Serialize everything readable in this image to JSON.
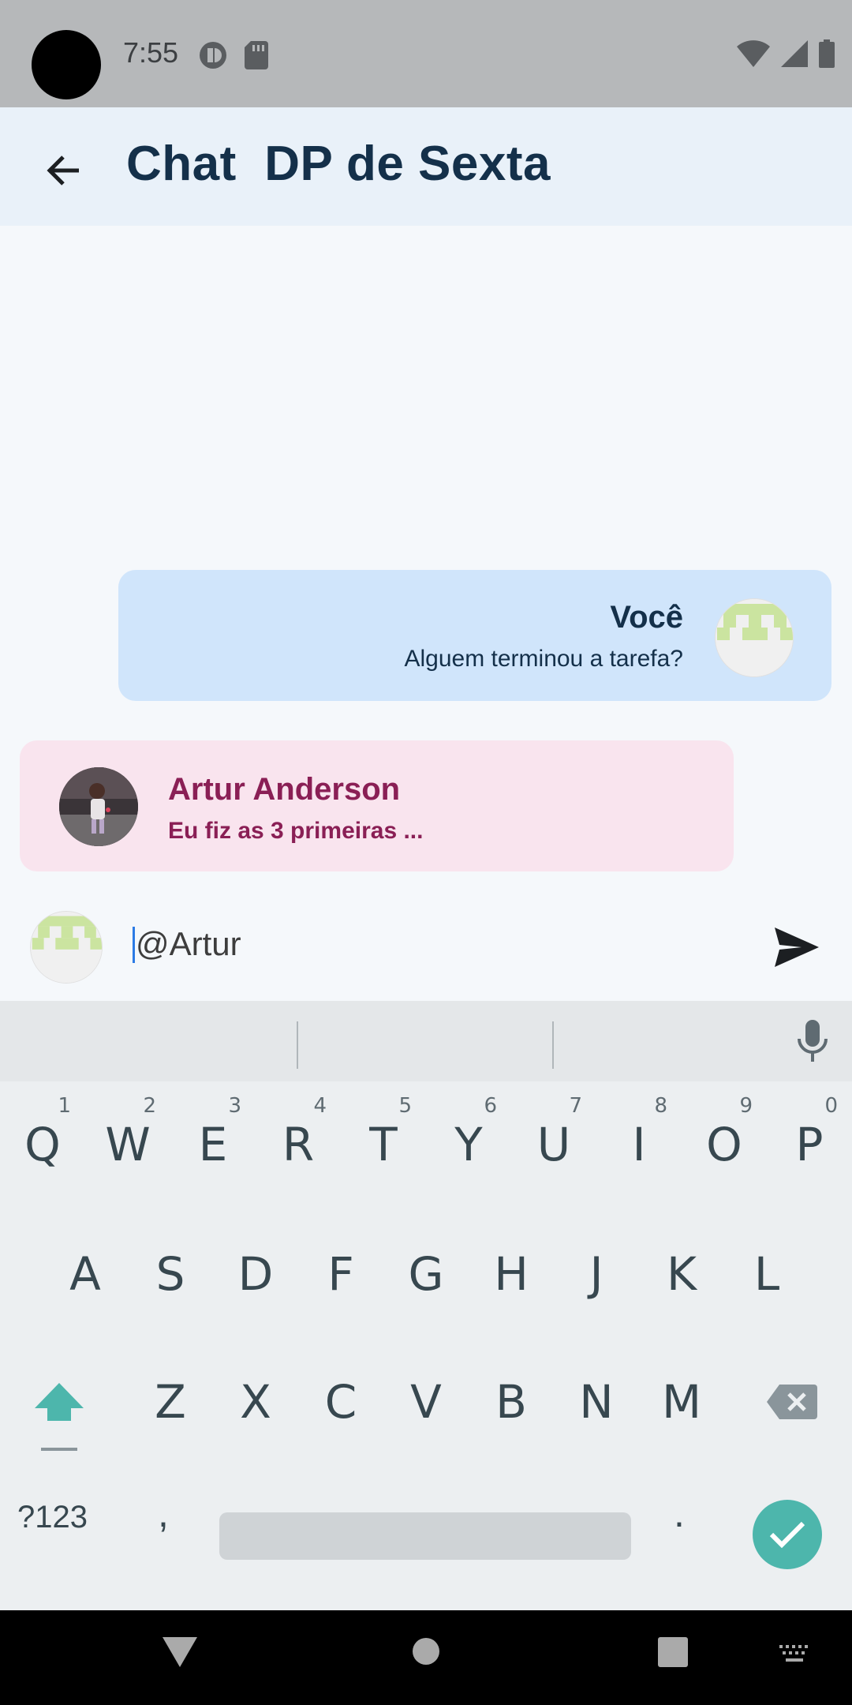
{
  "status_bar": {
    "time": "7:55"
  },
  "app_bar": {
    "title": "Chat  DP de Sexta"
  },
  "messages": [
    {
      "sender": "Você",
      "text": "Alguem terminou a tarefa?",
      "direction": "outgoing"
    },
    {
      "sender": "Artur Anderson",
      "text": "Eu fiz as 3 primeiras ...",
      "direction": "incoming"
    }
  ],
  "composer": {
    "value": "@Artur"
  },
  "keyboard": {
    "row1": [
      {
        "key": "Q",
        "hint": "1"
      },
      {
        "key": "W",
        "hint": "2"
      },
      {
        "key": "E",
        "hint": "3"
      },
      {
        "key": "R",
        "hint": "4"
      },
      {
        "key": "T",
        "hint": "5"
      },
      {
        "key": "Y",
        "hint": "6"
      },
      {
        "key": "U",
        "hint": "7"
      },
      {
        "key": "I",
        "hint": "8"
      },
      {
        "key": "O",
        "hint": "9"
      },
      {
        "key": "P",
        "hint": "0"
      }
    ],
    "row2": [
      "A",
      "S",
      "D",
      "F",
      "G",
      "H",
      "J",
      "K",
      "L"
    ],
    "row3": [
      "Z",
      "X",
      "C",
      "V",
      "B",
      "N",
      "M"
    ],
    "symbols_label": "?123",
    "comma": ",",
    "period": "."
  },
  "colors": {
    "app_bar_bg": "#e9f1f9",
    "outgoing_bubble": "#d0e5fb",
    "incoming_bubble": "#f9e4ee",
    "incoming_text": "#8a1f55",
    "title_text": "#14304a",
    "enter_key": "#4db6ac"
  }
}
